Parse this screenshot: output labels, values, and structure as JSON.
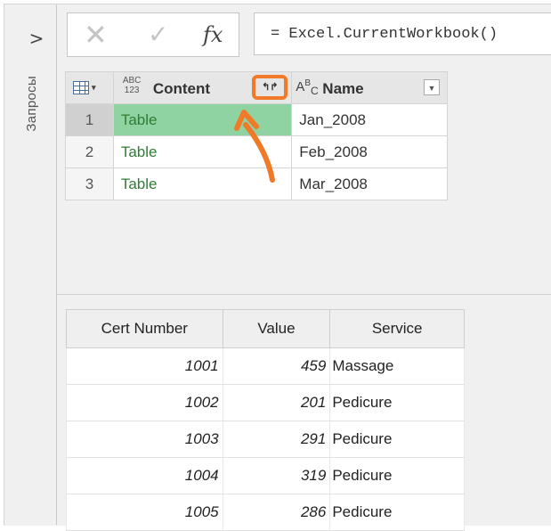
{
  "sidebar": {
    "expand_glyph": ">",
    "title": "Запросы"
  },
  "formula_bar": {
    "cancel_glyph": "✕",
    "confirm_glyph": "✓",
    "fx_label": "fx",
    "formula": "= Excel.CurrentWorkbook()"
  },
  "grid": {
    "headers": {
      "content_type": "ABC\n123",
      "content_label": "Content",
      "expand_glyph": "↰↱",
      "name_type": "A B C",
      "name_label": "Name"
    },
    "rows": [
      {
        "num": "1",
        "content": "Table",
        "name": "Jan_2008"
      },
      {
        "num": "2",
        "content": "Table",
        "name": "Feb_2008"
      },
      {
        "num": "3",
        "content": "Table",
        "name": "Mar_2008"
      }
    ]
  },
  "result": {
    "columns": [
      "Cert Number",
      "Value",
      "Service"
    ],
    "rows": [
      {
        "cert": "1001",
        "value": "459",
        "service": "Massage"
      },
      {
        "cert": "1002",
        "value": "201",
        "service": "Pedicure"
      },
      {
        "cert": "1003",
        "value": "291",
        "service": "Pedicure"
      },
      {
        "cert": "1004",
        "value": "319",
        "service": "Pedicure"
      },
      {
        "cert": "1005",
        "value": "286",
        "service": "Pedicure"
      }
    ]
  },
  "colors": {
    "accent_orange": "#f07a28",
    "selected_cell": "#8fd3a3",
    "table_text": "#2e7d32"
  }
}
